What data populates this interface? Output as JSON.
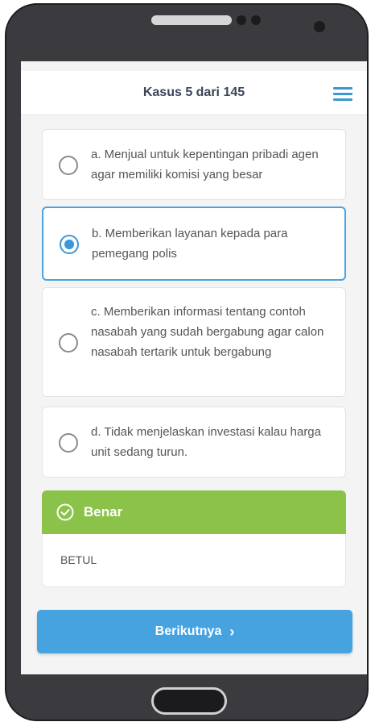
{
  "header": {
    "title": "Kasus 5 dari 145",
    "menu_icon": "hamburger-menu-icon",
    "accent": "#3c97d8"
  },
  "options": [
    {
      "text": "a.  Menjual untuk kepentingan pribadi agen agar memiliki komisi yang besar",
      "selected": false
    },
    {
      "text": "b.  Memberikan layanan kepada para pemegang polis",
      "selected": true
    },
    {
      "text": "c.   Memberikan informasi tentang contoh nasabah yang sudah bergabung  agar  calon nasabah tertarik untuk bergabung",
      "selected": false
    },
    {
      "text": "d.  Tidak menjelaskan investasi kalau harga unit sedang turun.",
      "selected": false
    }
  ],
  "result": {
    "title": "Benar",
    "explanation": "BETUL",
    "icon": "check-circle-icon",
    "color": "#8bc34a"
  },
  "footer": {
    "next_label": "Berikutnya",
    "next_icon": "chevron-right-icon",
    "button_color": "#46a3e0"
  }
}
